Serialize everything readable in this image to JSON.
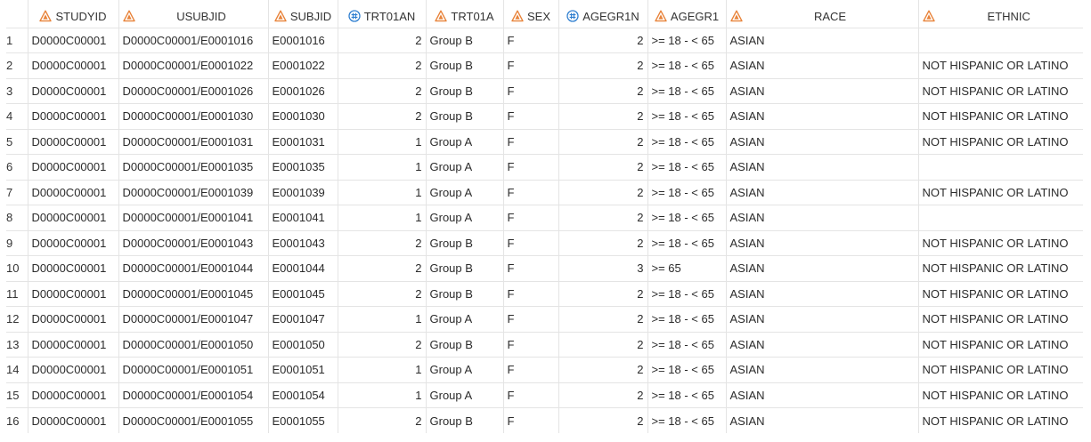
{
  "icons": {
    "char": "character-type-icon",
    "num": "numeric-type-icon",
    "char_color": "#e8833a",
    "num_color": "#2f7fd0"
  },
  "columns": [
    {
      "key": "STUDYID",
      "label": "STUDYID",
      "type": "char"
    },
    {
      "key": "USUBJID",
      "label": "USUBJID",
      "type": "char"
    },
    {
      "key": "SUBJID",
      "label": "SUBJID",
      "type": "char"
    },
    {
      "key": "TRT01AN",
      "label": "TRT01AN",
      "type": "num"
    },
    {
      "key": "TRT01A",
      "label": "TRT01A",
      "type": "char"
    },
    {
      "key": "SEX",
      "label": "SEX",
      "type": "char"
    },
    {
      "key": "AGEGR1N",
      "label": "AGEGR1N",
      "type": "num"
    },
    {
      "key": "AGEGR1",
      "label": "AGEGR1",
      "type": "char"
    },
    {
      "key": "RACE",
      "label": "RACE",
      "type": "char"
    },
    {
      "key": "ETHNIC",
      "label": "ETHNIC",
      "type": "char"
    }
  ],
  "rows": [
    {
      "n": "1",
      "cells": [
        "D0000C00001",
        "D0000C00001/E0001016",
        "E0001016",
        "2",
        "Group B",
        "F",
        "2",
        ">= 18 - < 65",
        "ASIAN",
        ""
      ]
    },
    {
      "n": "2",
      "cells": [
        "D0000C00001",
        "D0000C00001/E0001022",
        "E0001022",
        "2",
        "Group B",
        "F",
        "2",
        ">= 18 - < 65",
        "ASIAN",
        "NOT HISPANIC OR LATINO"
      ]
    },
    {
      "n": "3",
      "cells": [
        "D0000C00001",
        "D0000C00001/E0001026",
        "E0001026",
        "2",
        "Group B",
        "F",
        "2",
        ">= 18 - < 65",
        "ASIAN",
        "NOT HISPANIC OR LATINO"
      ]
    },
    {
      "n": "4",
      "cells": [
        "D0000C00001",
        "D0000C00001/E0001030",
        "E0001030",
        "2",
        "Group B",
        "F",
        "2",
        ">= 18 - < 65",
        "ASIAN",
        "NOT HISPANIC OR LATINO"
      ]
    },
    {
      "n": "5",
      "cells": [
        "D0000C00001",
        "D0000C00001/E0001031",
        "E0001031",
        "1",
        "Group A",
        "F",
        "2",
        ">= 18 - < 65",
        "ASIAN",
        "NOT HISPANIC OR LATINO"
      ]
    },
    {
      "n": "6",
      "cells": [
        "D0000C00001",
        "D0000C00001/E0001035",
        "E0001035",
        "1",
        "Group A",
        "F",
        "2",
        ">= 18 - < 65",
        "ASIAN",
        ""
      ]
    },
    {
      "n": "7",
      "cells": [
        "D0000C00001",
        "D0000C00001/E0001039",
        "E0001039",
        "1",
        "Group A",
        "F",
        "2",
        ">= 18 - < 65",
        "ASIAN",
        "NOT HISPANIC OR LATINO"
      ]
    },
    {
      "n": "8",
      "cells": [
        "D0000C00001",
        "D0000C00001/E0001041",
        "E0001041",
        "1",
        "Group A",
        "F",
        "2",
        ">= 18 - < 65",
        "ASIAN",
        ""
      ]
    },
    {
      "n": "9",
      "cells": [
        "D0000C00001",
        "D0000C00001/E0001043",
        "E0001043",
        "2",
        "Group B",
        "F",
        "2",
        ">= 18 - < 65",
        "ASIAN",
        "NOT HISPANIC OR LATINO"
      ]
    },
    {
      "n": "10",
      "cells": [
        "D0000C00001",
        "D0000C00001/E0001044",
        "E0001044",
        "2",
        "Group B",
        "F",
        "3",
        ">= 65",
        "ASIAN",
        "NOT HISPANIC OR LATINO"
      ]
    },
    {
      "n": "11",
      "cells": [
        "D0000C00001",
        "D0000C00001/E0001045",
        "E0001045",
        "2",
        "Group B",
        "F",
        "2",
        ">= 18 - < 65",
        "ASIAN",
        "NOT HISPANIC OR LATINO"
      ]
    },
    {
      "n": "12",
      "cells": [
        "D0000C00001",
        "D0000C00001/E0001047",
        "E0001047",
        "1",
        "Group A",
        "F",
        "2",
        ">= 18 - < 65",
        "ASIAN",
        "NOT HISPANIC OR LATINO"
      ]
    },
    {
      "n": "13",
      "cells": [
        "D0000C00001",
        "D0000C00001/E0001050",
        "E0001050",
        "2",
        "Group B",
        "F",
        "2",
        ">= 18 - < 65",
        "ASIAN",
        "NOT HISPANIC OR LATINO"
      ]
    },
    {
      "n": "14",
      "cells": [
        "D0000C00001",
        "D0000C00001/E0001051",
        "E0001051",
        "1",
        "Group A",
        "F",
        "2",
        ">= 18 - < 65",
        "ASIAN",
        "NOT HISPANIC OR LATINO"
      ]
    },
    {
      "n": "15",
      "cells": [
        "D0000C00001",
        "D0000C00001/E0001054",
        "E0001054",
        "1",
        "Group A",
        "F",
        "2",
        ">= 18 - < 65",
        "ASIAN",
        "NOT HISPANIC OR LATINO"
      ]
    },
    {
      "n": "16",
      "cells": [
        "D0000C00001",
        "D0000C00001/E0001055",
        "E0001055",
        "2",
        "Group B",
        "F",
        "2",
        ">= 18 - < 65",
        "ASIAN",
        "NOT HISPANIC OR LATINO"
      ]
    }
  ]
}
